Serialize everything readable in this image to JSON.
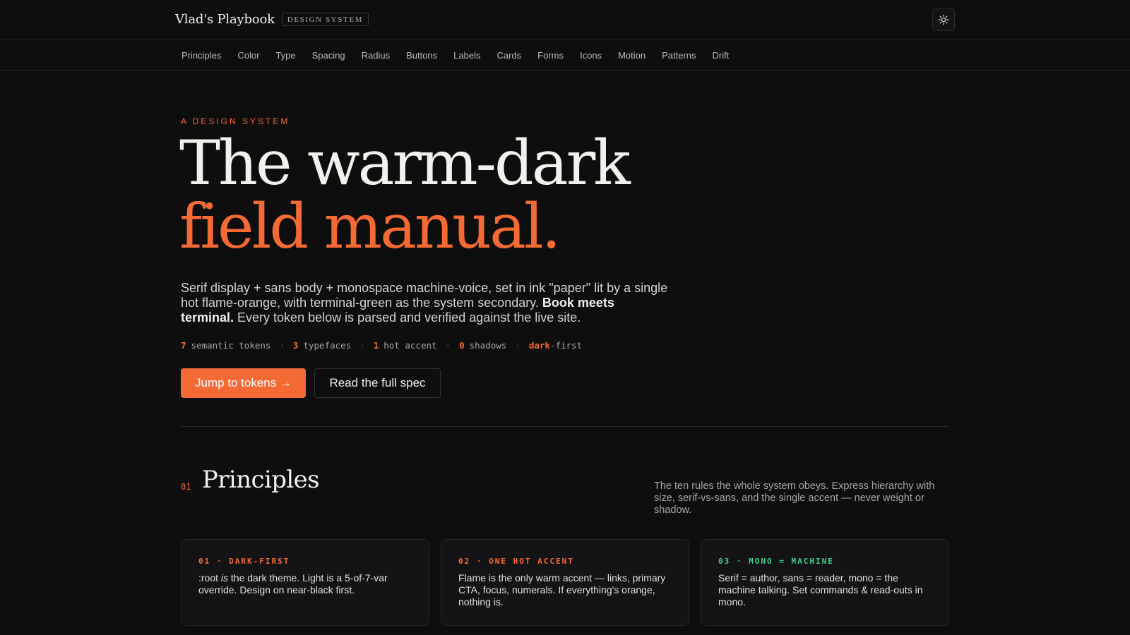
{
  "header": {
    "brand": "Vlad's Playbook",
    "badge": "DESIGN SYSTEM",
    "theme_toggle_icon": "sun-icon"
  },
  "nav": {
    "items": [
      "Principles",
      "Color",
      "Type",
      "Spacing",
      "Radius",
      "Buttons",
      "Labels",
      "Cards",
      "Forms",
      "Icons",
      "Motion",
      "Patterns",
      "Drift"
    ]
  },
  "hero": {
    "eyebrow": "A DESIGN SYSTEM",
    "headline_line1": "The warm-dark",
    "headline_line2": "field manual.",
    "lede_part1": "Serif display + sans body + monospace machine-voice, set in ink \"paper\" lit by a single hot flame-orange, with terminal-green as the system secondary. ",
    "lede_bold": "Book meets terminal.",
    "lede_part2": " Every token below is parsed and verified against the live site.",
    "stats": [
      {
        "num": "7",
        "label": "semantic tokens"
      },
      {
        "num": "3",
        "label": "typefaces"
      },
      {
        "num": "1",
        "label": "hot accent"
      },
      {
        "num": "0",
        "label": "shadows"
      }
    ],
    "stat_last_highlight": "dark",
    "stat_last_rest": "-first",
    "stat_separator": "·",
    "primary_cta": "Jump to tokens →",
    "secondary_cta": "Read the full spec"
  },
  "section": {
    "number": "01",
    "title": "Principles",
    "description": "The ten rules the whole system obeys. Express hierarchy with size, serif-vs-sans, and the single accent — never weight or shadow.",
    "cards": [
      {
        "tag": "01 · DARK-FIRST",
        "tag_color": "#f46a35",
        "body_before": ":root ",
        "body_em": "is",
        "body_after": " the dark theme. Light is a 5-of-7-var override. Design on near-black first."
      },
      {
        "tag": "02 · ONE HOT ACCENT",
        "tag_color": "#f46a35",
        "body_before": "Flame is the only warm accent — links, primary CTA, focus, numerals. If everything's orange, nothing is.",
        "body_em": "",
        "body_after": ""
      },
      {
        "tag": "03 · MONO = MACHINE",
        "tag_color": "#3ecf8e",
        "body_before": "Serif = author, sans = reader, mono = the machine talking. Set commands & read-outs in mono.",
        "body_em": "",
        "body_after": ""
      }
    ]
  },
  "colors": {
    "background": "#0e0e0f",
    "accent": "#f46a35",
    "secondary": "#3ecf8e"
  }
}
